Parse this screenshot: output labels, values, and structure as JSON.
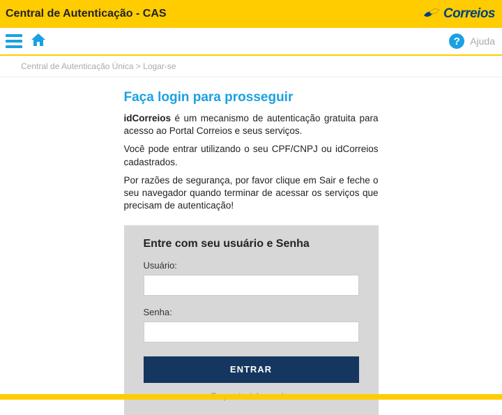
{
  "header": {
    "title": "Central de Autenticação - CAS",
    "logo_text": "Correios"
  },
  "nav": {
    "help_label": "Ajuda"
  },
  "breadcrumb": {
    "root": "Central de Autenticação Única",
    "sep": ">",
    "current": "Logar-se"
  },
  "main": {
    "heading": "Faça login para prosseguir",
    "intro_strong": "idCorreios",
    "intro_rest": " é um mecanismo de autenticação gratuita para acesso ao Portal Correios e seus serviços.",
    "para2": "Você pode entrar utilizando o seu CPF/CNPJ ou idCorreios cadastrados.",
    "para3": "Por razões de segurança, por favor clique em Sair e feche o seu navegador quando terminar de acessar os serviços que precisam de autenticação!"
  },
  "login": {
    "heading": "Entre com seu usuário e Senha",
    "user_label": "Usuário:",
    "pass_label": "Senha:",
    "submit": "ENTRAR",
    "forgot": "Esqueci minha senha"
  }
}
